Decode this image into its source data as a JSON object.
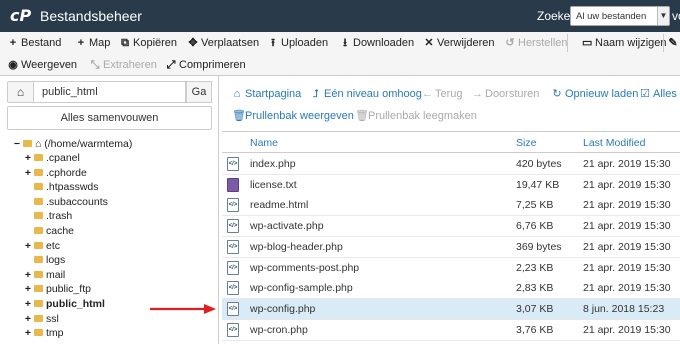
{
  "header": {
    "logo": "cP",
    "title": "Bestandsbeheer",
    "search_label": "Zoeken",
    "search_scope": "Al uw bestanden",
    "search_trail": "vo"
  },
  "toolbar": {
    "row1": [
      {
        "icon": "plus-icon",
        "glyph": "+",
        "label": "Bestand",
        "disabled": false
      },
      {
        "icon": "plus-icon",
        "glyph": "+",
        "label": "Map",
        "disabled": false
      },
      {
        "icon": "copy-icon",
        "glyph": "⧉",
        "label": "Kopiëren",
        "disabled": false
      },
      {
        "icon": "move-icon",
        "glyph": "✥",
        "label": "Verplaatsen",
        "disabled": false
      },
      {
        "icon": "upload-icon",
        "glyph": "⭱",
        "label": "Uploaden",
        "disabled": false
      },
      {
        "icon": "download-icon",
        "glyph": "⭳",
        "label": "Downloaden",
        "disabled": false
      },
      {
        "icon": "delete-icon",
        "glyph": "✕",
        "label": "Verwijderen",
        "disabled": false
      },
      {
        "icon": "restore-icon",
        "glyph": "↺",
        "label": "Herstellen",
        "disabled": true
      },
      {
        "icon": "rename-icon",
        "glyph": "▭",
        "label": "Naam wijzigen",
        "disabled": false
      },
      {
        "icon": "edit-icon",
        "glyph": "✎",
        "label": "",
        "disabled": false
      }
    ],
    "row2": [
      {
        "icon": "eye-icon",
        "glyph": "◉",
        "label": "Weergeven",
        "disabled": false
      },
      {
        "icon": "extract-icon",
        "glyph": "⤡",
        "label": "Extraheren",
        "disabled": true
      },
      {
        "icon": "compress-icon",
        "glyph": "⤢",
        "label": "Comprimeren",
        "disabled": false
      }
    ]
  },
  "sidebar": {
    "path_value": "public_html",
    "go_label": "Ga",
    "collapse_label": "Alles samenvouwen",
    "root_label": "(/home/warmtema)",
    "tree": [
      {
        "label": ".cpanel",
        "expandable": true,
        "bold": false
      },
      {
        "label": ".cphorde",
        "expandable": true,
        "bold": false
      },
      {
        "label": ".htpasswds",
        "expandable": false,
        "bold": false
      },
      {
        "label": ".subaccounts",
        "expandable": false,
        "bold": false
      },
      {
        "label": ".trash",
        "expandable": false,
        "bold": false
      },
      {
        "label": "cache",
        "expandable": false,
        "bold": false
      },
      {
        "label": "etc",
        "expandable": true,
        "bold": false
      },
      {
        "label": "logs",
        "expandable": false,
        "bold": false
      },
      {
        "label": "mail",
        "expandable": true,
        "bold": false
      },
      {
        "label": "public_ftp",
        "expandable": true,
        "bold": false
      },
      {
        "label": "public_html",
        "expandable": true,
        "bold": true
      },
      {
        "label": "ssl",
        "expandable": true,
        "bold": false
      },
      {
        "label": "tmp",
        "expandable": true,
        "bold": false
      }
    ]
  },
  "actions": {
    "home": "Startpagina",
    "up": "Eén niveau omhoog",
    "back": "Terug",
    "forward": "Doorsturen",
    "reload": "Opnieuw laden",
    "selectall": "Alles",
    "trash_view": "Prullenbak weergeven",
    "trash_empty": "Prullenbak leegmaken"
  },
  "table": {
    "col_name": "Name",
    "col_size": "Size",
    "col_modified": "Last Modified",
    "rows": [
      {
        "name": "index.php",
        "size": "420 bytes",
        "modified": "21 apr. 2019 15:30",
        "type": "php",
        "selected": false
      },
      {
        "name": "license.txt",
        "size": "19,47 KB",
        "modified": "21 apr. 2019 15:30",
        "type": "txt",
        "selected": false
      },
      {
        "name": "readme.html",
        "size": "7,25 KB",
        "modified": "21 apr. 2019 15:30",
        "type": "html",
        "selected": false
      },
      {
        "name": "wp-activate.php",
        "size": "6,76 KB",
        "modified": "21 apr. 2019 15:30",
        "type": "php",
        "selected": false
      },
      {
        "name": "wp-blog-header.php",
        "size": "369 bytes",
        "modified": "21 apr. 2019 15:30",
        "type": "php",
        "selected": false
      },
      {
        "name": "wp-comments-post.php",
        "size": "2,23 KB",
        "modified": "21 apr. 2019 15:30",
        "type": "php",
        "selected": false
      },
      {
        "name": "wp-config-sample.php",
        "size": "2,83 KB",
        "modified": "21 apr. 2019 15:30",
        "type": "php",
        "selected": false
      },
      {
        "name": "wp-config.php",
        "size": "3,07 KB",
        "modified": "8 jun. 2018 15:23",
        "type": "php",
        "selected": true
      },
      {
        "name": "wp-cron.php",
        "size": "3,76 KB",
        "modified": "21 apr. 2019 15:30",
        "type": "php",
        "selected": false
      }
    ]
  },
  "colors": {
    "header_bg": "#293a4a",
    "link_blue": "#2a7ab8",
    "selected_row": "#d9ebf7",
    "folder": "#e8b84a",
    "annotation_arrow": "#e02020"
  }
}
